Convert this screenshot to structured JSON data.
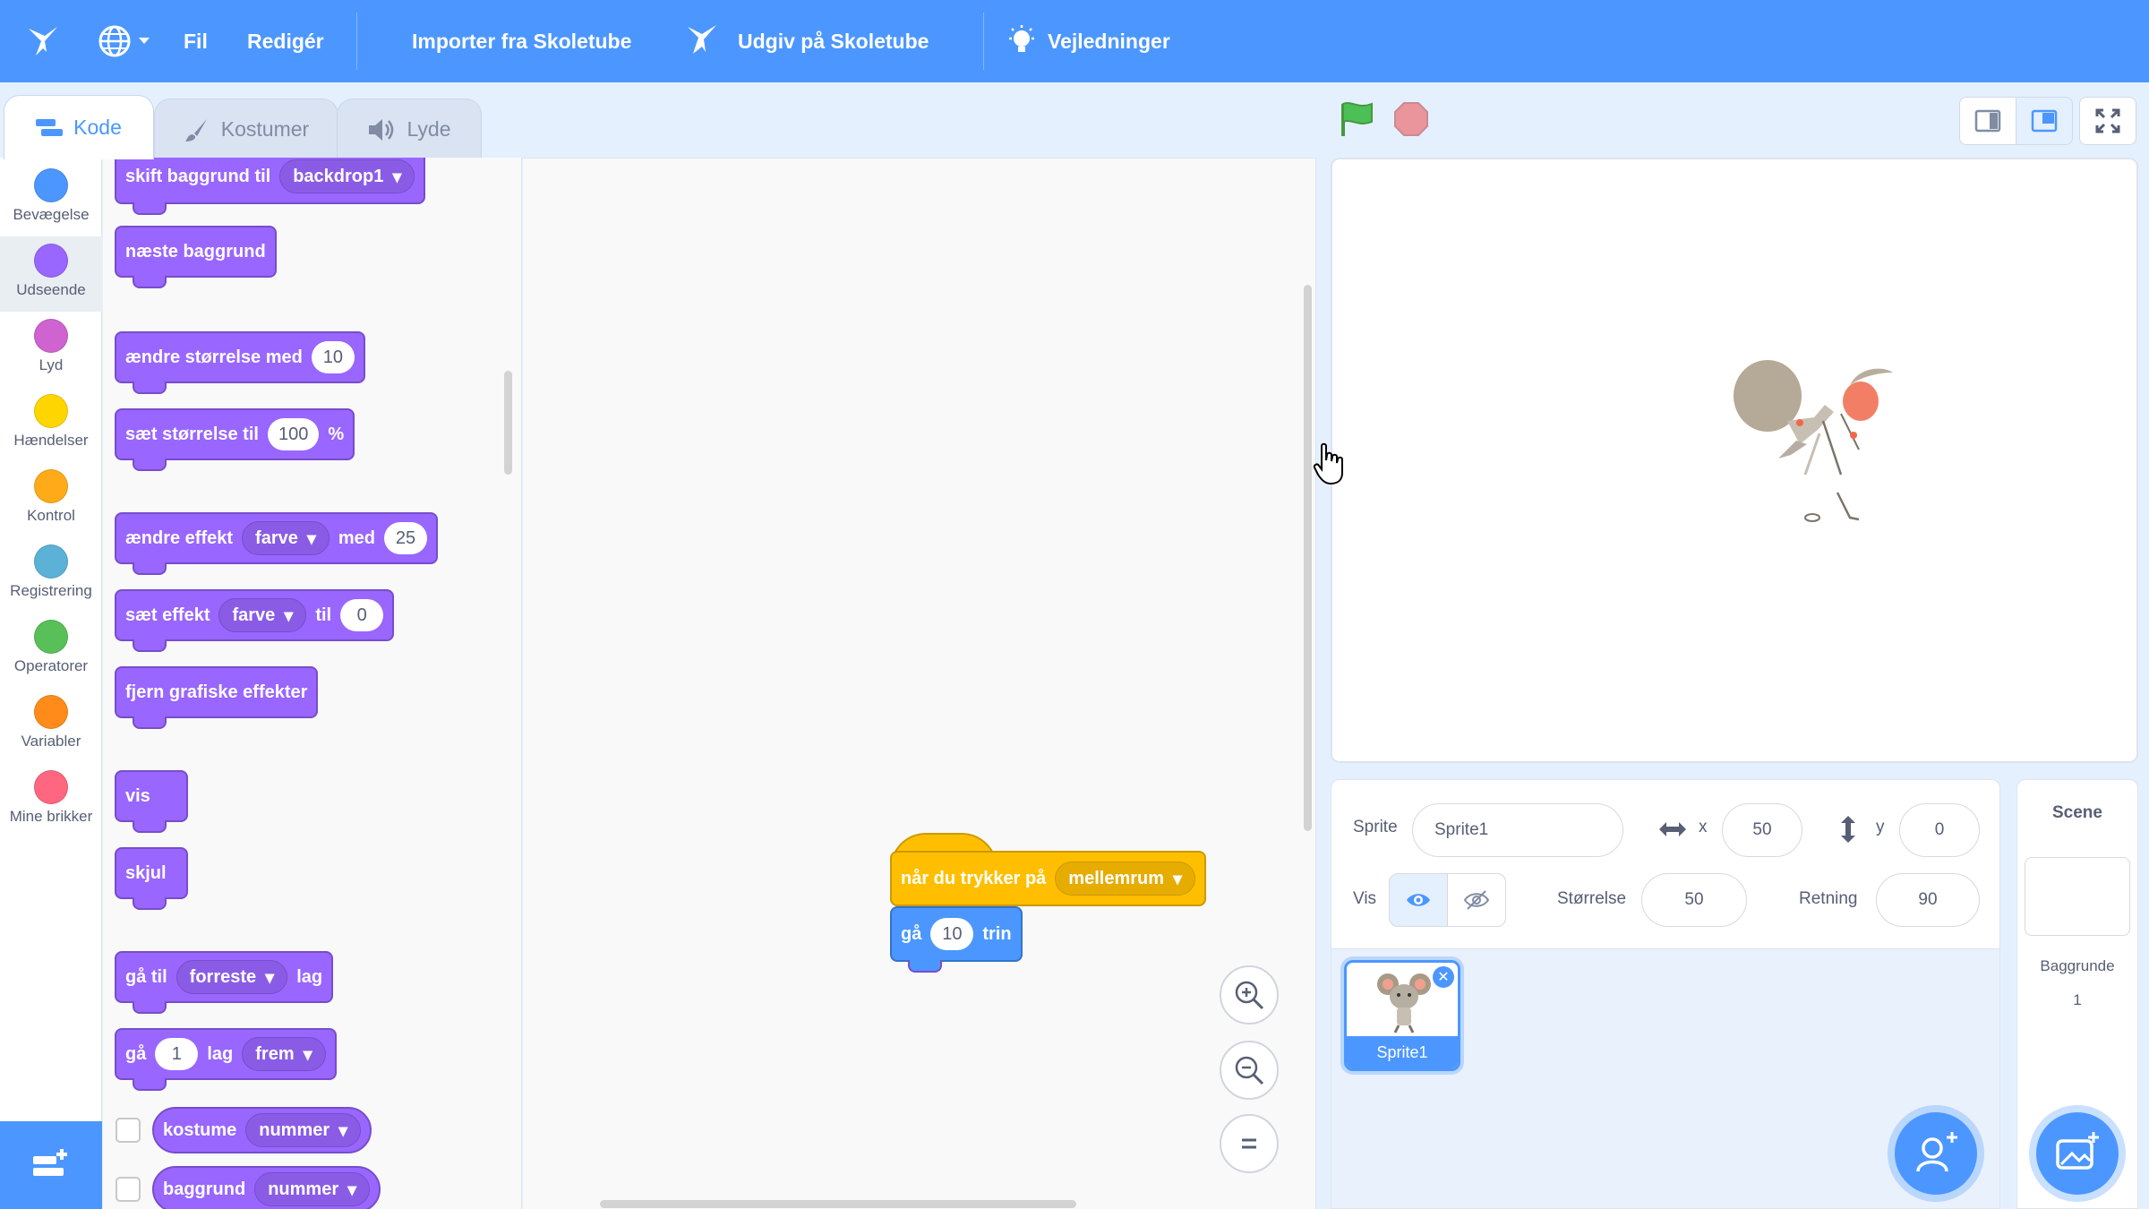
{
  "menu": {
    "file": "Fil",
    "edit": "Redigér",
    "import": "Importer fra Skoletube",
    "publish": "Udgiv på Skoletube",
    "tutorials": "Vejledninger"
  },
  "tabs": {
    "code": "Kode",
    "costumes": "Kostumer",
    "sounds": "Lyde"
  },
  "categories": [
    {
      "label": "Bevægelse",
      "color": "#4c97ff"
    },
    {
      "label": "Udseende",
      "color": "#9966ff"
    },
    {
      "label": "Lyd",
      "color": "#cf63cf"
    },
    {
      "label": "Hændelser",
      "color": "#ffd500"
    },
    {
      "label": "Kontrol",
      "color": "#ffab19"
    },
    {
      "label": "Registrering",
      "color": "#5cb1d6"
    },
    {
      "label": "Operatorer",
      "color": "#59c059"
    },
    {
      "label": "Variabler",
      "color": "#ff8c1a"
    },
    {
      "label": "Mine brikker",
      "color": "#ff6680"
    }
  ],
  "palette": {
    "switch_backdrop": {
      "label": "skift baggrund til",
      "value": "backdrop1"
    },
    "next_backdrop": "næste baggrund",
    "change_size": {
      "label": "ændre størrelse med",
      "value": "10"
    },
    "set_size": {
      "label": "sæt størrelse til",
      "value": "100",
      "unit": "%"
    },
    "change_effect": {
      "label": "ændre effekt",
      "effect": "farve",
      "mid": "med",
      "value": "25"
    },
    "set_effect": {
      "label": "sæt effekt",
      "effect": "farve",
      "mid": "til",
      "value": "0"
    },
    "clear_effects": "fjern grafiske effekter",
    "show": "vis",
    "hide": "skjul",
    "go_to_layer": {
      "label": "gå til",
      "value": "forreste",
      "suffix": "lag"
    },
    "go_layers": {
      "label": "gå",
      "value": "1",
      "mid": "lag",
      "dir": "frem"
    },
    "costume": {
      "label": "kostume",
      "value": "nummer"
    },
    "backdrop": {
      "label": "baggrund",
      "value": "nummer"
    }
  },
  "script": {
    "hat": {
      "label": "når du trykker på",
      "key": "mellemrum"
    },
    "move": {
      "label": "gå",
      "value": "10",
      "suffix": "trin"
    }
  },
  "sprite_info": {
    "sprite_label": "Sprite",
    "sprite_name": "Sprite1",
    "x_label": "x",
    "x": "50",
    "y_label": "y",
    "y": "0",
    "show_label": "Vis",
    "size_label": "Størrelse",
    "size": "50",
    "direction_label": "Retning",
    "direction": "90"
  },
  "sprite_list": [
    {
      "name": "Sprite1"
    }
  ],
  "scene": {
    "title": "Scene",
    "backdrops_label": "Baggrunde",
    "backdrops_count": "1"
  }
}
